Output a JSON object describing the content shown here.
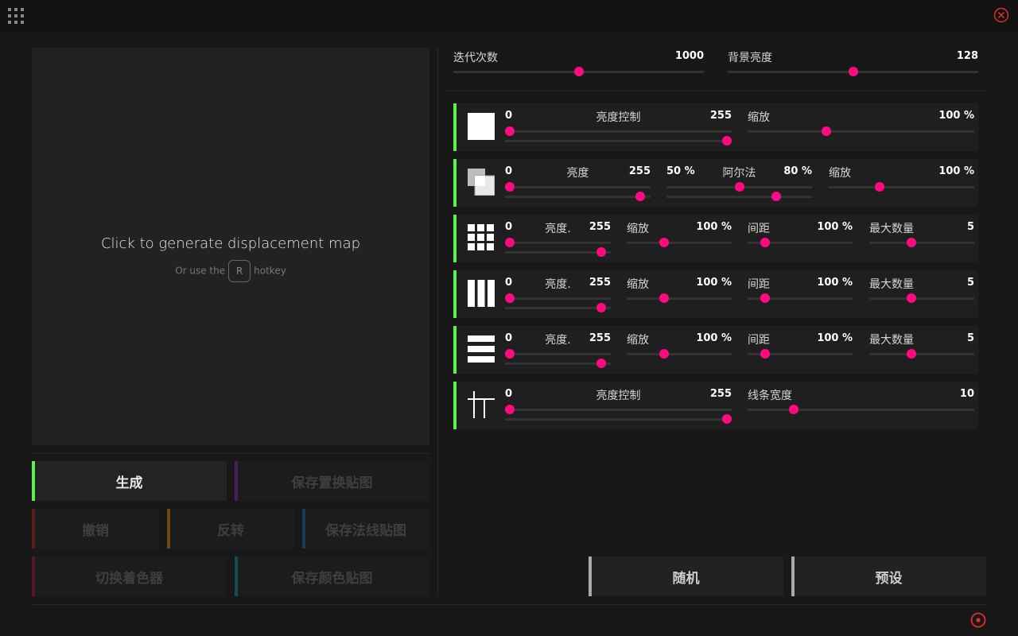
{
  "preview": {
    "title": "Click to generate displacement map",
    "hint_before": "Or use the",
    "hint_key": "R",
    "hint_after": "hotkey"
  },
  "buttons": {
    "generate": "生成",
    "save_displacement": "保存置换贴图",
    "undo": "撤销",
    "invert": "反转",
    "save_normal": "保存法线贴图",
    "switch_shader": "切换着色器",
    "save_color": "保存颜色贴图",
    "random": "随机",
    "preset": "预设"
  },
  "colors": {
    "accent_green": "#5ff050",
    "slider_knob": "#ff0a80",
    "undo_bar": "#5a1e1e",
    "invert_bar": "#6a4a12",
    "save_normal_bar": "#1e3a5a",
    "save_disp_bar": "#4a1e5a",
    "switch_shader_bar": "#5a1432",
    "save_color_bar": "#144a55"
  },
  "global": {
    "iterations": {
      "label": "迭代次数",
      "value": "1000",
      "fraction": 0.5
    },
    "bg_brightness": {
      "label": "背景亮度",
      "value": "128",
      "fraction": 0.5
    }
  },
  "rows": [
    {
      "icon": "solid-square-icon",
      "range": {
        "min": "0",
        "label": "亮度控制",
        "max": "255",
        "low": 0.0,
        "high": 1.0
      },
      "params": [
        {
          "label": "缩放",
          "value": "100 %",
          "fraction": 0.34
        }
      ]
    },
    {
      "icon": "overlap-squares-icon",
      "range": {
        "min": "0",
        "label": "亮度",
        "max": "255",
        "low": 0.0,
        "high": 0.96
      },
      "alpha": {
        "min": "50 %",
        "label": "阿尔法",
        "max": "80 %",
        "low": 0.5,
        "high": 0.77
      },
      "params": [
        {
          "label": "缩放",
          "value": "100 %",
          "fraction": 0.34
        }
      ]
    },
    {
      "icon": "grid-squares-icon",
      "range": {
        "min": "0",
        "label": "亮度.",
        "max": "255",
        "low": 0.0,
        "high": 0.95
      },
      "params": [
        {
          "label": "缩放",
          "value": "100 %",
          "fraction": 0.34
        },
        {
          "label": "间距",
          "value": "100 %",
          "fraction": 0.13
        },
        {
          "label": "最大数量",
          "value": "5",
          "fraction": 0.39
        }
      ]
    },
    {
      "icon": "vertical-bars-icon",
      "range": {
        "min": "0",
        "label": "亮度.",
        "max": "255",
        "low": 0.0,
        "high": 0.95
      },
      "params": [
        {
          "label": "缩放",
          "value": "100 %",
          "fraction": 0.34
        },
        {
          "label": "间距",
          "value": "100 %",
          "fraction": 0.13
        },
        {
          "label": "最大数量",
          "value": "5",
          "fraction": 0.39
        }
      ]
    },
    {
      "icon": "horizontal-bars-icon",
      "range": {
        "min": "0",
        "label": "亮度.",
        "max": "255",
        "low": 0.0,
        "high": 0.95
      },
      "params": [
        {
          "label": "缩放",
          "value": "100 %",
          "fraction": 0.34
        },
        {
          "label": "间距",
          "value": "100 %",
          "fraction": 0.13
        },
        {
          "label": "最大数量",
          "value": "5",
          "fraction": 0.39
        }
      ]
    },
    {
      "icon": "lines-icon",
      "range": {
        "min": "0",
        "label": "亮度控制",
        "max": "255",
        "low": 0.0,
        "high": 1.0
      },
      "params": [
        {
          "label": "线条宽度",
          "value": "10",
          "fraction": 0.19
        }
      ]
    }
  ]
}
